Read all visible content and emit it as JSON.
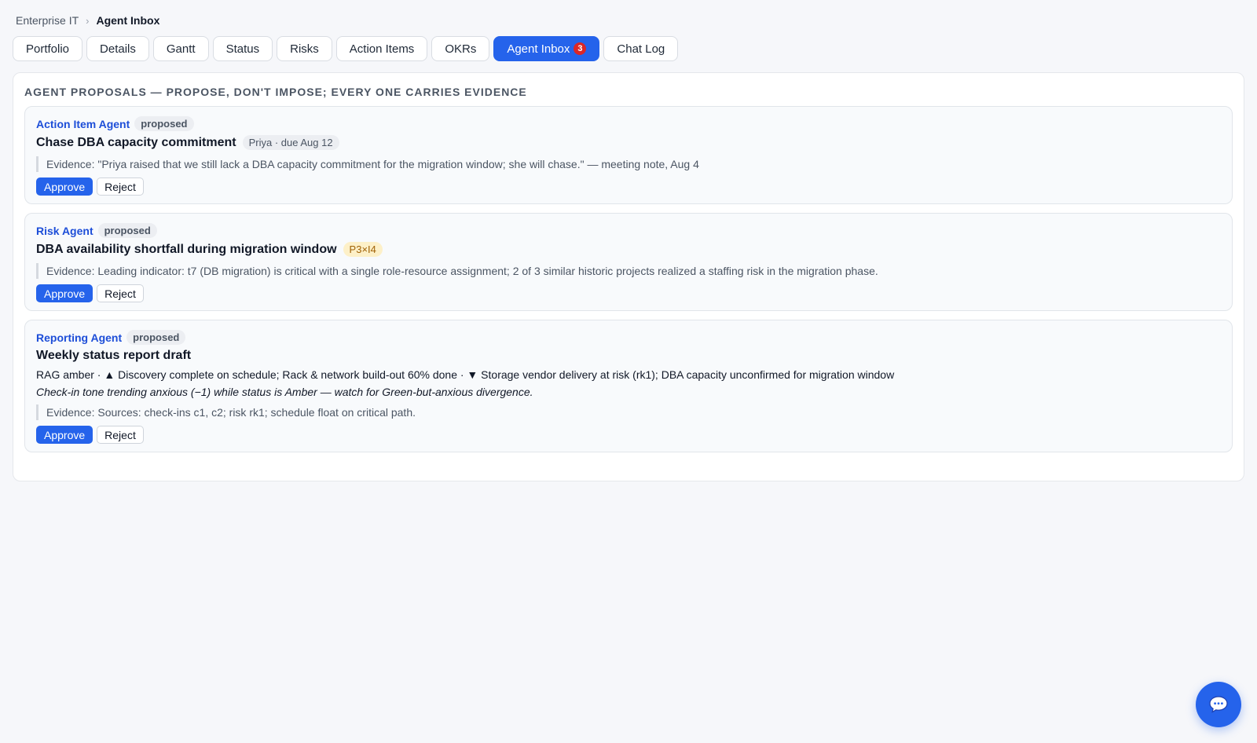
{
  "breadcrumb": {
    "root": "Enterprise IT",
    "separator": "›",
    "current": "Agent Inbox"
  },
  "tabs": [
    {
      "label": "Portfolio"
    },
    {
      "label": "Details"
    },
    {
      "label": "Gantt"
    },
    {
      "label": "Status"
    },
    {
      "label": "Risks"
    },
    {
      "label": "Action Items"
    },
    {
      "label": "OKRs"
    },
    {
      "label": "Agent Inbox",
      "badge": "3",
      "active": true
    },
    {
      "label": "Chat Log"
    }
  ],
  "panel": {
    "title": "Agent Proposals — propose, don't impose; every one carries evidence"
  },
  "proposals": [
    {
      "agent": "Action Item Agent",
      "status": "proposed",
      "title": "Chase DBA capacity commitment",
      "meta": "Priya · due Aug 12",
      "evidence": "Evidence: \"Priya raised that we still lack a DBA capacity commitment for the migration window; she will chase.\" — meeting note, Aug 4",
      "approve_label": "Approve",
      "reject_label": "Reject"
    },
    {
      "agent": "Risk Agent",
      "status": "proposed",
      "title": "DBA availability shortfall during migration window",
      "score": "P3×I4",
      "evidence": "Evidence: Leading indicator: t7 (DB migration) is critical with a single role-resource assignment; 2 of 3 similar historic projects realized a staffing risk in the migration phase.",
      "approve_label": "Approve",
      "reject_label": "Reject"
    },
    {
      "agent": "Reporting Agent",
      "status": "proposed",
      "title": "Weekly status report draft",
      "summary": "RAG amber · ▲ Discovery complete on schedule; Rack & network build-out 60% done · ▼ Storage vendor delivery at risk (rk1); DBA capacity unconfirmed for migration window",
      "note": "Check-in tone trending anxious (−1) while status is Amber — watch for Green-but-anxious divergence.",
      "evidence": "Evidence: Sources: check-ins c1, c2; risk rk1; schedule float on critical path.",
      "approve_label": "Approve",
      "reject_label": "Reject"
    }
  ],
  "colors": {
    "accent": "#2563eb",
    "badge": "#dc2626",
    "background": "#f6f7fa"
  },
  "icons": {
    "chat_fab": "chat-bubble-icon"
  }
}
